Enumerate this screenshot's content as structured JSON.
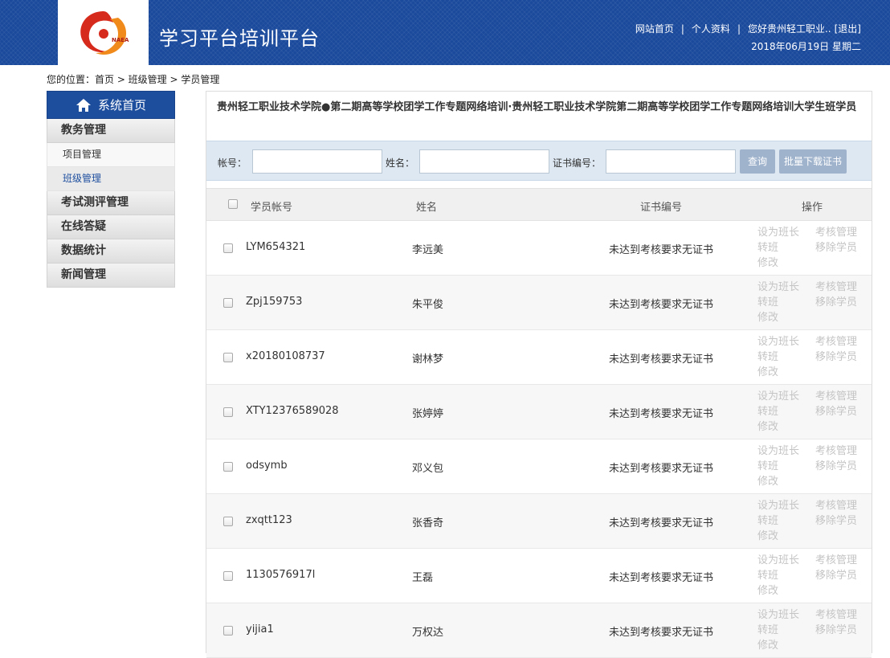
{
  "header": {
    "logo_text": "NAEA",
    "site_title": "学习平台培训平台",
    "links": [
      "网站首页",
      "个人资料",
      "您好贵州轻工职业..",
      "[退出]"
    ],
    "date": "2018年06月19日 星期二",
    "bg_color": "#1b4a9c"
  },
  "breadcrumb": "您的位置：首页 > 班级管理 > 学员管理",
  "sidebar": {
    "home_label": "系统首页",
    "home_icon": "home-icon",
    "sections": [
      {
        "label": "教务管理",
        "items": [
          "项目管理",
          "班级管理"
        ]
      },
      {
        "label": "考试测评管理"
      },
      {
        "label": "在线答疑"
      },
      {
        "label": "数据统计"
      },
      {
        "label": "新闻管理"
      }
    ],
    "active_item": "班级管理"
  },
  "main": {
    "title": "贵州轻工职业技术学院●第二期高等学校团学工作专题网络培训·贵州轻工职业技术学院第二期高等学校团学工作专题网络培训大学生班学员",
    "search": {
      "account_label": "帐号：",
      "name_label": "姓名：",
      "cert_label": "证书编号：",
      "account_value": "",
      "name_value": "",
      "cert_value": "",
      "query_button": "查询",
      "batch_button": "批量下载证书"
    },
    "table": {
      "columns": [
        "学员帐号",
        "姓名",
        "证书编号",
        "操作"
      ],
      "ops": [
        "设为班长",
        "考核管理",
        "转班",
        "移除学员",
        "修改"
      ],
      "rows": [
        {
          "account": "LYM654321",
          "name": "李远美",
          "cert": "未达到考核要求无证书"
        },
        {
          "account": "Zpj159753",
          "name": "朱平俊",
          "cert": "未达到考核要求无证书"
        },
        {
          "account": "x20180108737",
          "name": "谢林梦",
          "cert": "未达到考核要求无证书"
        },
        {
          "account": "XTY12376589028",
          "name": "张婷婷",
          "cert": "未达到考核要求无证书"
        },
        {
          "account": "odsymb",
          "name": "邓义包",
          "cert": "未达到考核要求无证书"
        },
        {
          "account": "zxqtt123",
          "name": "张香奇",
          "cert": "未达到考核要求无证书"
        },
        {
          "account": "1130576917l",
          "name": "王磊",
          "cert": "未达到考核要求无证书"
        },
        {
          "account": "yijia1",
          "name": "万权达",
          "cert": "未达到考核要求无证书"
        }
      ]
    }
  }
}
